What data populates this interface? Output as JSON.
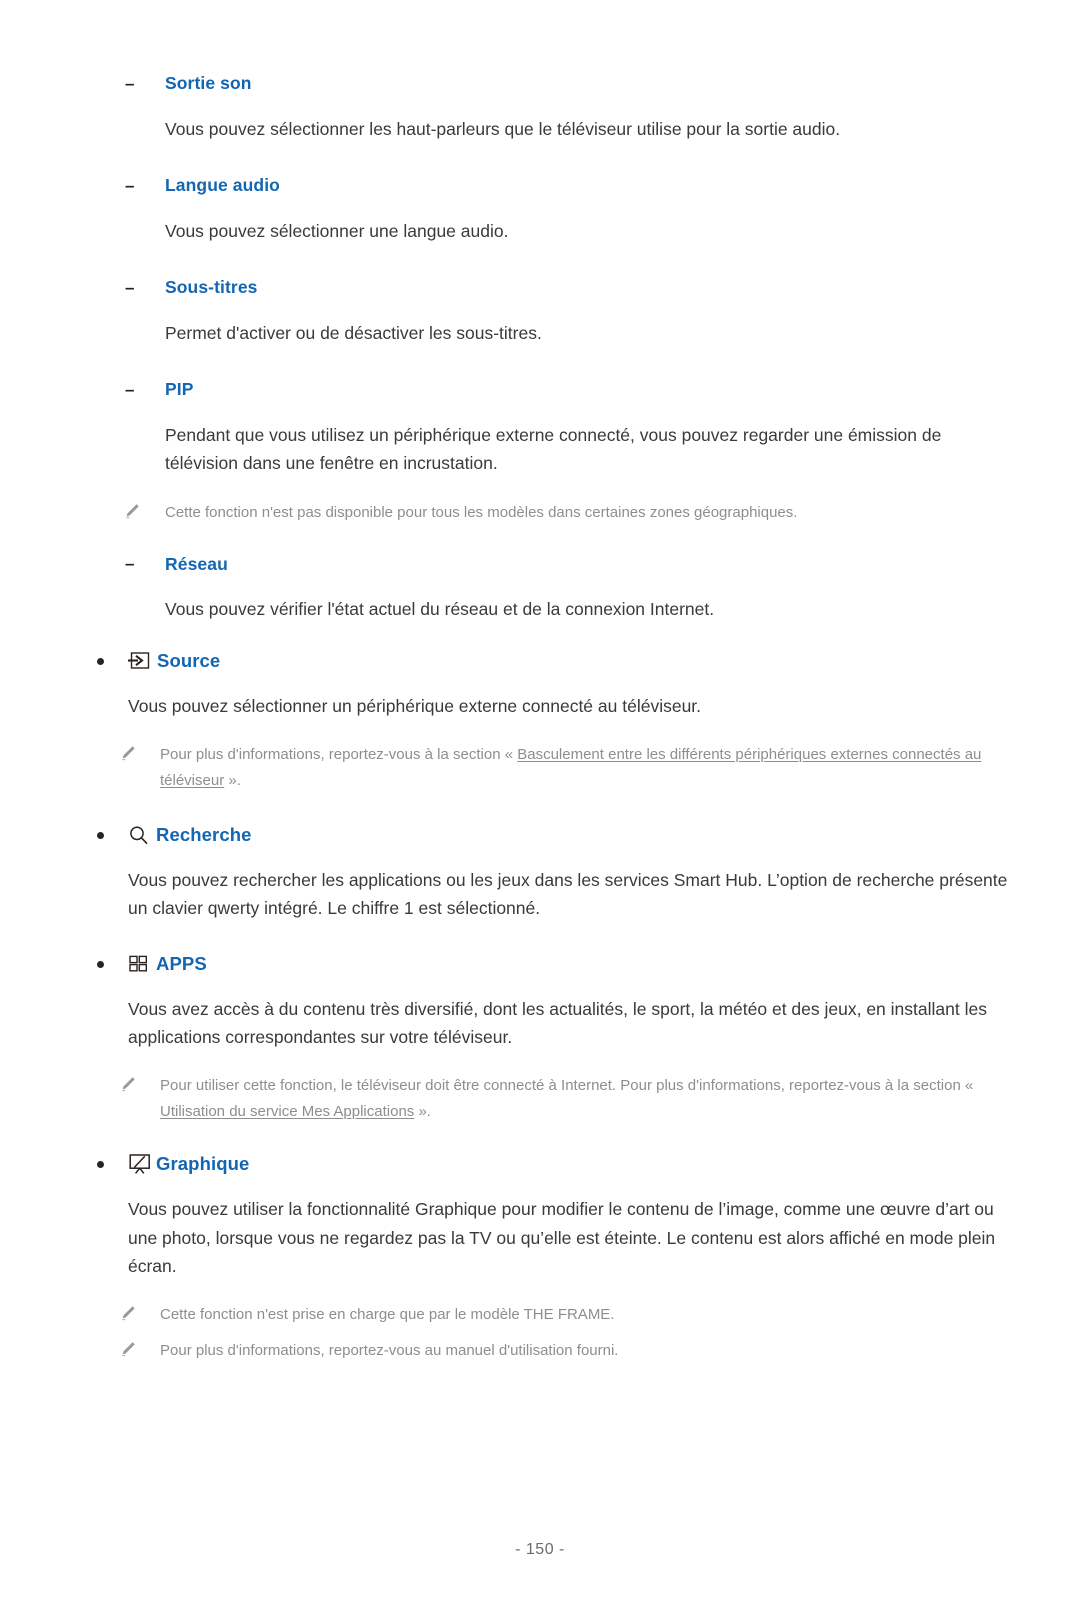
{
  "colors": {
    "heading_blue": "#1266b2",
    "body_text": "#3a3a3a",
    "note_text": "#8e8e8e",
    "bullet": "#2a2320"
  },
  "sections": {
    "sortie_son": {
      "dash": "–",
      "title": "Sortie son",
      "body": "Vous pouvez sélectionner les haut-parleurs que le téléviseur utilise pour la sortie audio."
    },
    "langue_audio": {
      "dash": "–",
      "title": "Langue audio",
      "body": "Vous pouvez sélectionner une langue audio."
    },
    "sous_titres": {
      "dash": "–",
      "title": "Sous-titres",
      "body": "Permet d'activer ou de désactiver les sous-titres."
    },
    "pip": {
      "dash": "–",
      "title": "PIP",
      "body": "Pendant que vous utilisez un périphérique externe connecté, vous pouvez regarder une émission de télévision dans une fenêtre en incrustation.",
      "note": "Cette fonction n'est pas disponible pour tous les modèles dans certaines zones géographiques."
    },
    "reseau": {
      "dash": "–",
      "title": "Réseau",
      "body": "Vous pouvez vérifier l'état actuel du réseau et de la connexion Internet."
    },
    "source": {
      "icon": "source-input-icon",
      "title": "Source",
      "body": "Vous pouvez sélectionner un périphérique externe connecté au téléviseur.",
      "note_prefix": "Pour plus d'informations, reportez-vous à la section « ",
      "note_link": "Basculement entre les différents périphériques externes connectés au téléviseur",
      "note_suffix": " »."
    },
    "recherche": {
      "icon": "search-icon",
      "title": "Recherche",
      "body": "Vous pouvez rechercher les applications ou les jeux dans les services Smart Hub. L’option de recherche présente un clavier qwerty intégré. Le chiffre 1 est sélectionné."
    },
    "apps": {
      "icon": "apps-grid-icon",
      "title": "APPS",
      "body": "Vous avez accès à du contenu très diversifié, dont les actualités, le sport, la météo et des jeux, en installant les applications correspondantes sur votre téléviseur.",
      "note_prefix": "Pour utiliser cette fonction, le téléviseur doit être connecté à Internet. Pour plus d'informations, reportez-vous à la section « ",
      "note_link": "Utilisation du service Mes Applications",
      "note_suffix": " »."
    },
    "graphique": {
      "icon": "art-frame-icon",
      "title": "Graphique",
      "body": "Vous pouvez utiliser la fonctionnalité Graphique pour modifier le contenu de l’image, comme une œuvre d’art ou une photo, lorsque vous ne regardez pas la TV ou qu’elle est éteinte. Le contenu est alors affiché en mode plein écran.",
      "note1": "Cette fonction n'est prise en charge que par le modèle THE FRAME.",
      "note2": "Pour plus d'informations, reportez-vous au manuel d'utilisation fourni."
    }
  },
  "footer": {
    "page_number": "- 150 -"
  }
}
